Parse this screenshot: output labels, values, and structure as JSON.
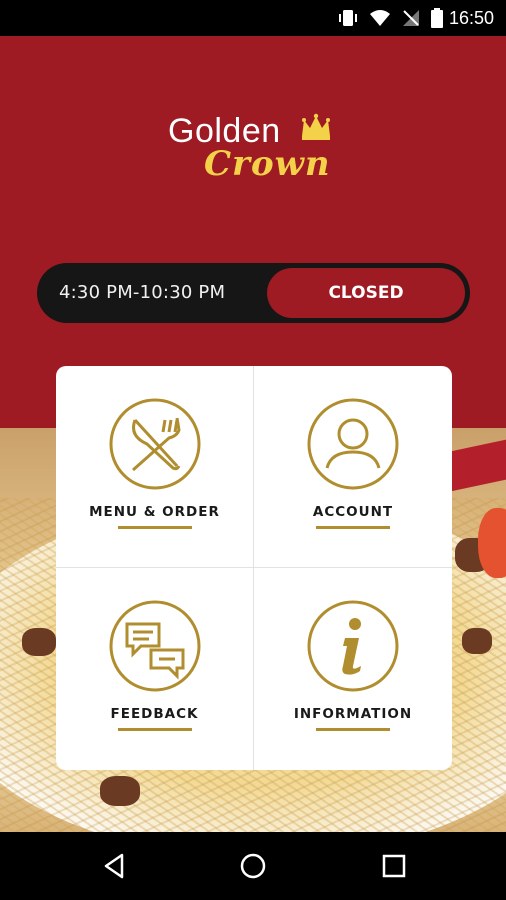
{
  "status_bar": {
    "time": "16:50"
  },
  "brand": {
    "line1": "Golden",
    "line2": "Crown"
  },
  "hours": {
    "range": "4:30 PM-10:30 PM",
    "status": "CLOSED"
  },
  "tiles": [
    {
      "label": "MENU & ORDER",
      "icon": "knife-fork-icon"
    },
    {
      "label": "ACCOUNT",
      "icon": "user-icon"
    },
    {
      "label": "FEEDBACK",
      "icon": "chat-bubbles-icon"
    },
    {
      "label": "INFORMATION",
      "icon": "info-icon"
    }
  ],
  "colors": {
    "brand_red": "#9e1b23",
    "gold": "#b08d2e",
    "logo_yellow": "#f3d24a"
  }
}
